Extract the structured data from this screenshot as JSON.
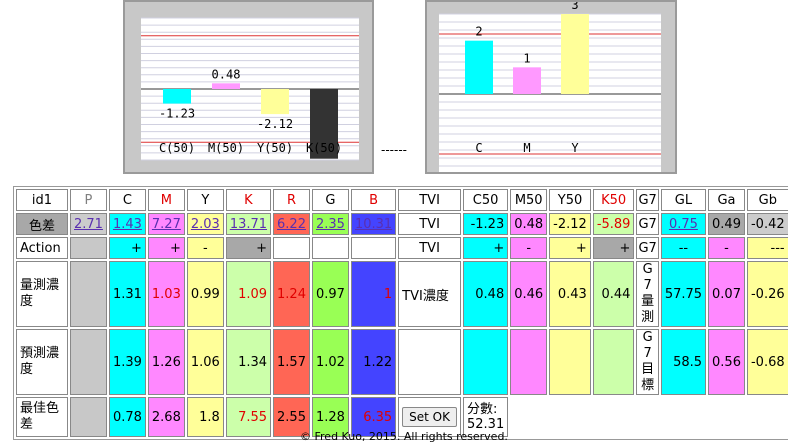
{
  "chart_data": [
    {
      "type": "bar",
      "categories": [
        "C(50)",
        "M(50)",
        "Y(50)",
        "K(50)"
      ],
      "values": [
        -1.23,
        0.48,
        -2.12,
        -5.89
      ],
      "data_labels": [
        "-1.23",
        "0.48",
        "-2.12",
        ""
      ],
      "colors": [
        "#00ffff",
        "#ff99ff",
        "#ffff99",
        "#333333"
      ],
      "ylim": [
        -6,
        6
      ]
    },
    {
      "type": "bar",
      "categories": [
        "C",
        "M",
        "Y"
      ],
      "values": [
        2,
        1,
        3
      ],
      "data_labels": [
        "2",
        "1",
        "3"
      ],
      "colors": [
        "#00ffff",
        "#ff99ff",
        "#ffff99"
      ],
      "ylim": [
        -3,
        3
      ]
    }
  ],
  "separator_text": "------",
  "table": {
    "header": {
      "id": "id1",
      "P": "P",
      "C": "C",
      "M": "M",
      "Y": "Y",
      "K": "K",
      "R": "R",
      "G": "G",
      "B": "B",
      "TVI": "TVI",
      "C50": "C50",
      "M50": "M50",
      "Y50": "Y50",
      "K50": "K50",
      "G7": "G7",
      "GL": "GL",
      "Ga": "Ga",
      "Gb": "Gb"
    },
    "delta": {
      "label": "色差",
      "P": "2.71",
      "C": "1.43",
      "M": "7.27",
      "Y": "2.03",
      "K": "13.71",
      "R": "6.22",
      "G": "2.35",
      "B": "10.31",
      "TVI": "TVI",
      "C50": "-1.23",
      "M50": "0.48",
      "Y50": "-2.12",
      "K50": "-5.89",
      "G7": "G7",
      "GL": "0.75",
      "Ga": "0.49",
      "Gb": "-0.42"
    },
    "action": {
      "label": "Action",
      "C": "+",
      "M": "+",
      "Y": "-",
      "K": "+",
      "TVI": "TVI",
      "C50": "+",
      "M50": "-",
      "Y50": "+",
      "K50": "+",
      "G7": "G7",
      "GL": "--",
      "Ga": "-",
      "Gb": "---"
    },
    "measured": {
      "label": "量測濃度",
      "C": "1.31",
      "M": "1.03",
      "Y": "0.99",
      "K": "1.09",
      "R": "1.24",
      "G": "0.97",
      "B": "1",
      "TVI": "TVI濃度",
      "C50": "0.48",
      "M50": "0.46",
      "Y50": "0.43",
      "K50": "0.44",
      "G7": "G7量測",
      "GL": "57.75",
      "Ga": "0.07",
      "Gb": "-0.26"
    },
    "predicted": {
      "label": "預測濃度",
      "C": "1.39",
      "M": "1.26",
      "Y": "1.06",
      "K": "1.34",
      "R": "1.57",
      "G": "1.02",
      "B": "1.22",
      "G7": "G7目標",
      "GL": "58.5",
      "Ga": "0.56",
      "Gb": "-0.68"
    },
    "best": {
      "label": "最佳色差",
      "C": "0.78",
      "M": "2.68",
      "Y": "1.8",
      "K": "7.55",
      "R": "2.55",
      "G": "1.28",
      "B": "6.35",
      "button": "Set OK",
      "score_label": "分數:",
      "score": "52.31"
    }
  },
  "footer": "© Fred Kuo, 2015. All rights reserved."
}
